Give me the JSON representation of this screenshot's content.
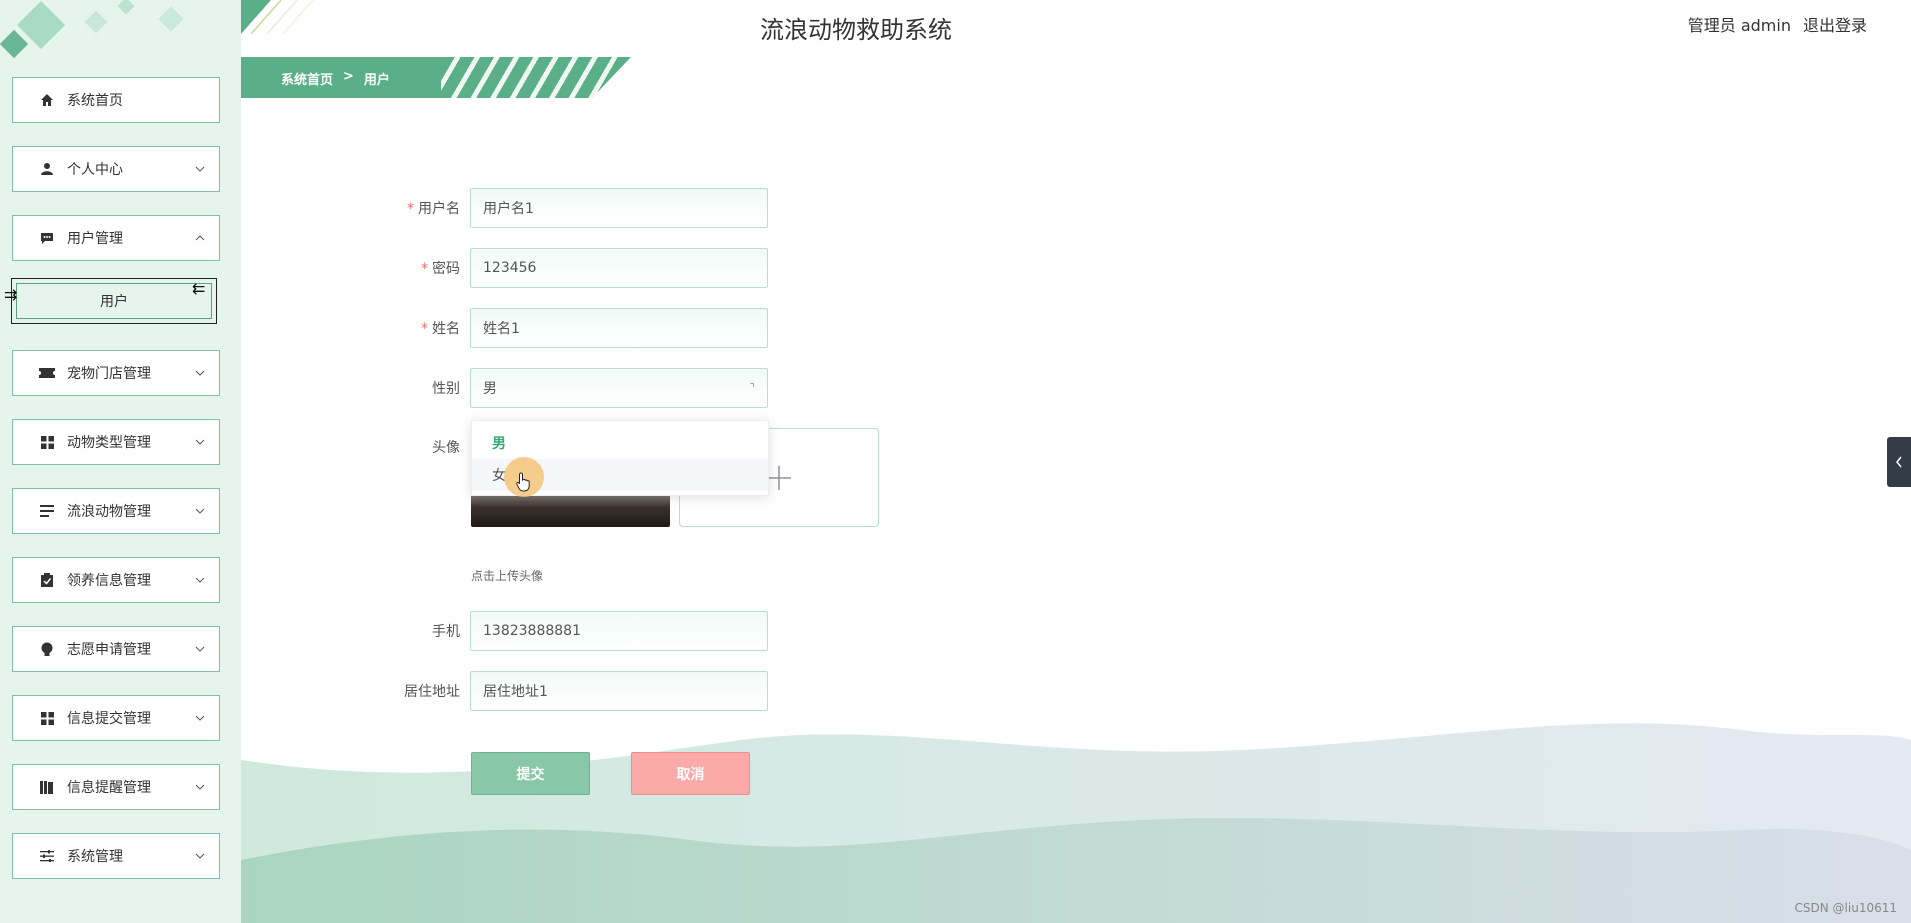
{
  "app": {
    "title": "流浪动物救助系统",
    "user_label": "管理员 admin",
    "logout_label": "退出登录"
  },
  "breadcrumb": {
    "home": "系统首页",
    "sep": ">",
    "current": "用户"
  },
  "sidebar": {
    "items": [
      {
        "label": "系统首页",
        "icon": "home-icon"
      },
      {
        "label": "个人中心",
        "icon": "person-icon"
      },
      {
        "label": "用户管理",
        "icon": "chat-icon",
        "expanded": true
      },
      {
        "label": "宠物门店管理",
        "icon": "ticket-icon"
      },
      {
        "label": "动物类型管理",
        "icon": "grid-icon"
      },
      {
        "label": "流浪动物管理",
        "icon": "list-icon"
      },
      {
        "label": "领养信息管理",
        "icon": "clipboard-icon"
      },
      {
        "label": "志愿申请管理",
        "icon": "bulb-icon"
      },
      {
        "label": "信息提交管理",
        "icon": "grid-icon"
      },
      {
        "label": "信息提醒管理",
        "icon": "book-icon"
      },
      {
        "label": "系统管理",
        "icon": "sliders-icon"
      }
    ],
    "submenu": {
      "label": "用户"
    }
  },
  "form": {
    "username": {
      "label": "用户名",
      "value": "用户名1"
    },
    "password": {
      "label": "密码",
      "value": "123456"
    },
    "name": {
      "label": "姓名",
      "value": "姓名1"
    },
    "gender": {
      "label": "性别",
      "value": "男",
      "options": [
        "男",
        "女"
      ]
    },
    "avatar": {
      "label": "头像",
      "tip": "点击上传头像"
    },
    "phone": {
      "label": "手机",
      "value": "13823888881"
    },
    "address": {
      "label": "居住地址",
      "value": "居住地址1"
    },
    "submit_label": "提交",
    "cancel_label": "取消"
  },
  "watermark": "CSDN @liu10611",
  "colors": {
    "accent": "#5aaf88",
    "cancel": "#fbaaaa",
    "required": "#f56c6c"
  }
}
